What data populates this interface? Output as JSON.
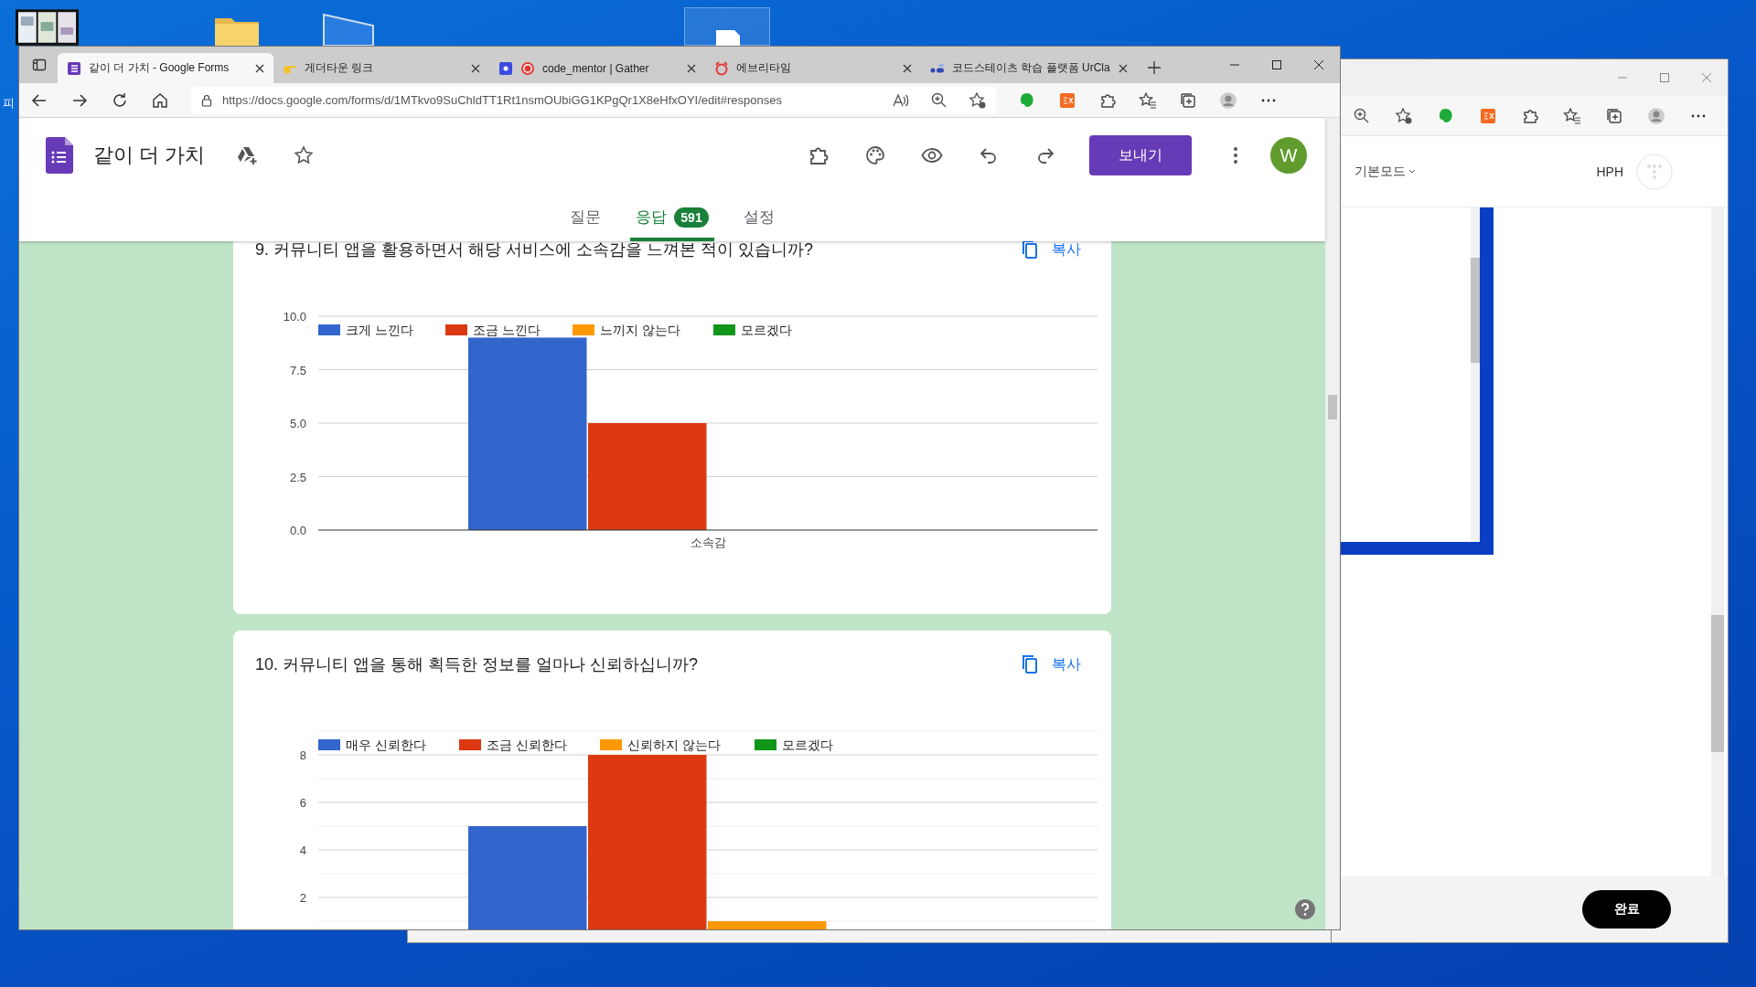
{
  "desktop": {
    "icon_label": "피"
  },
  "browser": {
    "tabs": [
      {
        "title": "같이 더 가치 - Google Forms",
        "selected": true
      },
      {
        "title": "게더타운 링크",
        "selected": false
      },
      {
        "title": "code_mentor | Gather",
        "selected": false
      },
      {
        "title": "에브리타임",
        "selected": false
      },
      {
        "title": "코드스테이츠 학습 플랫폼 UrCla",
        "selected": false
      }
    ],
    "address": "https://docs.google.com/forms/d/1MTkvo9SuChldTT1Rt1nsmOUbiGG1KPgQr1X8eHfxOYI/edit#responses",
    "form": {
      "title": "같이 더 가치",
      "send_button": "보내기",
      "avatar_letter": "W",
      "tabs": [
        {
          "label": "질문",
          "selected": false
        },
        {
          "label": "응답",
          "selected": true,
          "badge": "591"
        },
        {
          "label": "설정",
          "selected": false
        }
      ],
      "questions": [
        {
          "title": "9. 커뮤니티 앱을 활용하면서 해당 서비스에 소속감을 느껴본 적이 있습니까?",
          "copy_label": "복사",
          "chart_data": {
            "type": "bar",
            "categories": [
              "소속감"
            ],
            "ylim": [
              0,
              10
            ],
            "grid": true,
            "legend": "top",
            "yticks": [
              {
                "value": 0,
                "label": "0.0"
              },
              {
                "value": 2.5,
                "label": "2.5"
              },
              {
                "value": 5,
                "label": "5.0"
              },
              {
                "value": 7.5,
                "label": "7.5"
              },
              {
                "value": 10,
                "label": "10.0"
              }
            ],
            "series": [
              {
                "name": "크게 느낀다",
                "color": "#3366cc",
                "values": [
                  9
                ]
              },
              {
                "name": "조금 느낀다",
                "color": "#dc3912",
                "values": [
                  5
                ]
              },
              {
                "name": "느끼지 않는다",
                "color": "#ff9900",
                "values": [
                  0
                ]
              },
              {
                "name": "모르겠다",
                "color": "#109618",
                "values": [
                  0
                ]
              }
            ]
          }
        },
        {
          "title": "10. 커뮤니티 앱을 통해 획득한 정보를 얼마나 신뢰하십니까?",
          "copy_label": "복사",
          "chart_data": {
            "type": "bar",
            "ylim": [
              0,
              9
            ],
            "grid": true,
            "legend": "top",
            "yticks": [
              2,
              4,
              6,
              8
            ],
            "series": [
              {
                "name": "매우 신뢰한다",
                "color": "#3366cc",
                "values": [
                  5
                ]
              },
              {
                "name": "조금 신뢰한다",
                "color": "#dc3912",
                "values": [
                  8
                ]
              },
              {
                "name": "신뢰하지 않는다",
                "color": "#ff9900",
                "values": [
                  1
                ]
              },
              {
                "name": "모르겠다",
                "color": "#109618",
                "values": [
                  0
                ]
              }
            ]
          }
        }
      ]
    }
  },
  "second_window": {
    "mode_menu": "기본모드",
    "user": "HPH",
    "done_button": "완료"
  }
}
